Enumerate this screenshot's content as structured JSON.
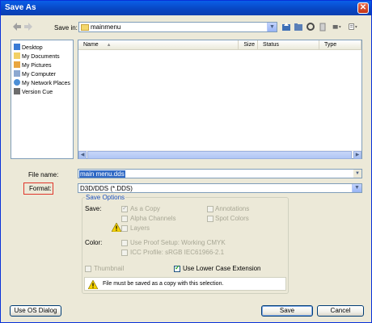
{
  "window": {
    "title": "Save As",
    "close_glyph": "✕"
  },
  "save_in": {
    "label": "Save in:",
    "value": "mainmenu"
  },
  "toolbar": {
    "icons": [
      "back-icon",
      "forward-icon",
      "up-folder-icon",
      "new-folder-icon",
      "refresh-icon",
      "delete-icon",
      "view-menu-icon",
      "tools-menu-icon"
    ]
  },
  "places": [
    {
      "label": "Desktop",
      "icon": "desktop-icon"
    },
    {
      "label": "My Documents",
      "icon": "documents-icon"
    },
    {
      "label": "My Pictures",
      "icon": "pictures-icon"
    },
    {
      "label": "My Computer",
      "icon": "computer-icon"
    },
    {
      "label": "My Network Places",
      "icon": "network-icon"
    },
    {
      "label": "Version Cue",
      "icon": "version-cue-icon"
    }
  ],
  "filelist": {
    "columns": [
      "Name",
      "Size",
      "Status",
      "Type"
    ],
    "sort_glyph": "▲"
  },
  "file_name": {
    "label": "File name:",
    "value": "main menu.dds"
  },
  "format": {
    "label": "Format:",
    "value": "D3D/DDS (*.DDS)"
  },
  "save_options": {
    "title": "Save Options",
    "save_label": "Save:",
    "as_a_copy": "As a Copy",
    "annotations": "Annotations",
    "alpha_channels": "Alpha Channels",
    "spot_colors": "Spot Colors",
    "layers": "Layers",
    "color_label": "Color:",
    "use_proof_setup": "Use Proof Setup:  Working CMYK",
    "icc_profile": "ICC Profile:  sRGB IEC61966-2.1",
    "thumbnail": "Thumbnail",
    "use_lower_case": "Use Lower Case Extension",
    "notice": "File must be saved as a copy with this selection."
  },
  "buttons": {
    "use_os_dialog": "Use OS Dialog",
    "save": "Save",
    "cancel": "Cancel"
  },
  "colors": {
    "titlebar": "#0A5FE8",
    "dialog_bg": "#ECE9D8",
    "selection": "#316AC5",
    "group_title": "#1A4FBE",
    "highlight_border": "#E0362A"
  }
}
